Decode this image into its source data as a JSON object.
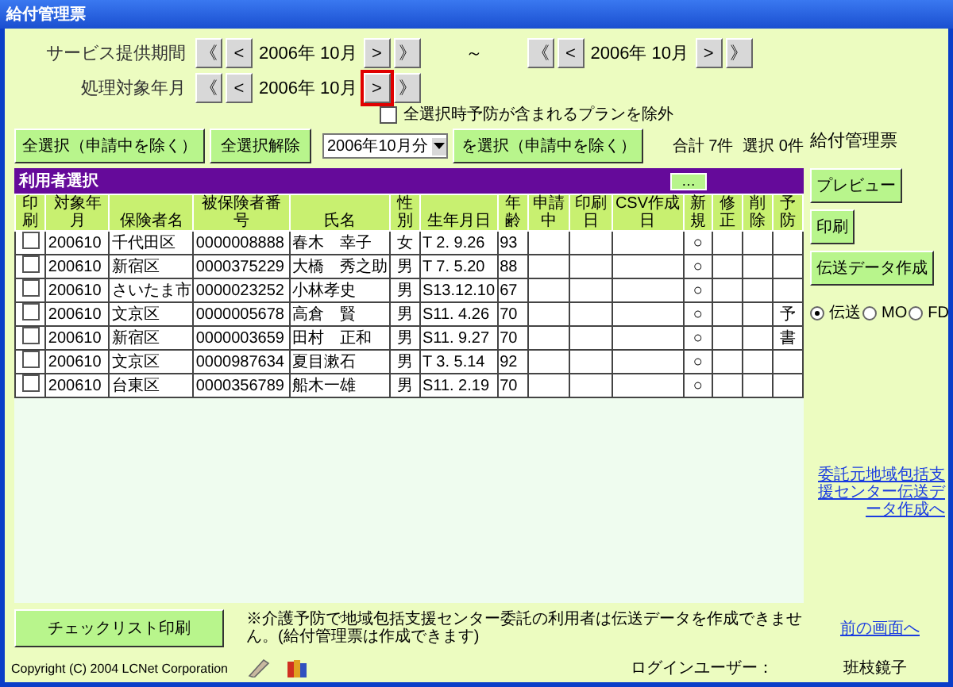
{
  "window": {
    "title": "給付管理票"
  },
  "period": {
    "label": "サービス提供期間",
    "separator": "～",
    "from": {
      "before": [
        {
          "label": "《",
          "focused": false
        },
        {
          "label": "<",
          "focused": false
        }
      ],
      "value": "2006年 10月",
      "after": [
        {
          "label": ">",
          "focused": false
        },
        {
          "label": "》",
          "focused": false
        }
      ]
    },
    "to": {
      "before": [
        {
          "label": "《",
          "focused": false
        },
        {
          "label": "<",
          "focused": false
        }
      ],
      "value": "2006年 10月",
      "after": [
        {
          "label": ">",
          "focused": false
        },
        {
          "label": "》",
          "focused": false
        }
      ]
    }
  },
  "processing": {
    "label": "処理対象年月",
    "month": {
      "before": [
        {
          "label": "《",
          "focused": false
        },
        {
          "label": "<",
          "focused": false
        }
      ],
      "value": "2006年 10月",
      "after": [
        {
          "label": ">",
          "focused": true
        },
        {
          "label": "》",
          "focused": false
        }
      ]
    }
  },
  "exclude_option": {
    "label": "全選択時予防が含まれるプランを除外",
    "checked": false
  },
  "toolbar": {
    "select_all": "全選択（申請中を除く）",
    "deselect_all": "全選択解除",
    "month_select": {
      "value": "2006年10月分"
    },
    "select_by_month": "を選択（申請中を除く）",
    "total": "合計 7件",
    "selected_count": "選択 0件"
  },
  "user_list": {
    "title": "利用者選択",
    "more_button": "…",
    "print_column": "印刷",
    "columns": [
      "対象年月",
      "保険者名",
      "被保険者番号",
      "氏名",
      "性別",
      "生年月日",
      "年齢",
      "申請中",
      "印刷日",
      "CSV作成日",
      "新規",
      "修正",
      "削除",
      "予防"
    ],
    "rows": [
      {
        "print": false,
        "cells": [
          "200610",
          "千代田区",
          "0000008888",
          "春木　幸子",
          "女",
          "T 2. 9.26",
          "93",
          "",
          "",
          "",
          "○",
          "",
          "",
          ""
        ]
      },
      {
        "print": false,
        "cells": [
          "200610",
          "新宿区",
          "0000375229",
          "大橋　秀之助",
          "男",
          "T 7. 5.20",
          "88",
          "",
          "",
          "",
          "○",
          "",
          "",
          ""
        ]
      },
      {
        "print": false,
        "cells": [
          "200610",
          "さいたま市",
          "0000023252",
          "小林孝史",
          "男",
          "S13.12.10",
          "67",
          "",
          "",
          "",
          "○",
          "",
          "",
          ""
        ]
      },
      {
        "print": false,
        "cells": [
          "200610",
          "文京区",
          "0000005678",
          "高倉　賢",
          "男",
          "S11. 4.26",
          "70",
          "",
          "",
          "",
          "○",
          "",
          "",
          "予"
        ]
      },
      {
        "print": false,
        "cells": [
          "200610",
          "新宿区",
          "0000003659",
          "田村　正和",
          "男",
          "S11. 9.27",
          "70",
          "",
          "",
          "",
          "○",
          "",
          "",
          "書"
        ]
      },
      {
        "print": false,
        "cells": [
          "200610",
          "文京区",
          "0000987634",
          "夏目漱石",
          "男",
          "T 3. 5.14",
          "92",
          "",
          "",
          "",
          "○",
          "",
          "",
          ""
        ]
      },
      {
        "print": false,
        "cells": [
          "200610",
          "台東区",
          "0000356789",
          "船木一雄",
          "男",
          "S11. 2.19",
          "70",
          "",
          "",
          "",
          "○",
          "",
          "",
          ""
        ]
      }
    ]
  },
  "side": {
    "title": "給付管理票",
    "buttons": [
      "プレビュー",
      "印刷",
      "伝送データ作成"
    ],
    "output_options": [
      {
        "label": "伝送",
        "selected": true
      },
      {
        "label": "MO",
        "selected": false
      },
      {
        "label": "FD",
        "selected": false
      }
    ],
    "link": "委託元地域包括支援センター伝送データ作成へ"
  },
  "bottom": {
    "checklist_button": "チェックリスト印刷",
    "note": "※介護予防で地域包括支援センター委託の利用者は伝送データを作成できません。(給付管理票は作成できます)",
    "back_link": "前の画面へ"
  },
  "footer": {
    "copyright": "Copyright (C) 2004 LCNet Corporation",
    "login_label": "ログインユーザー：",
    "login_user": "班枝鏡子"
  }
}
